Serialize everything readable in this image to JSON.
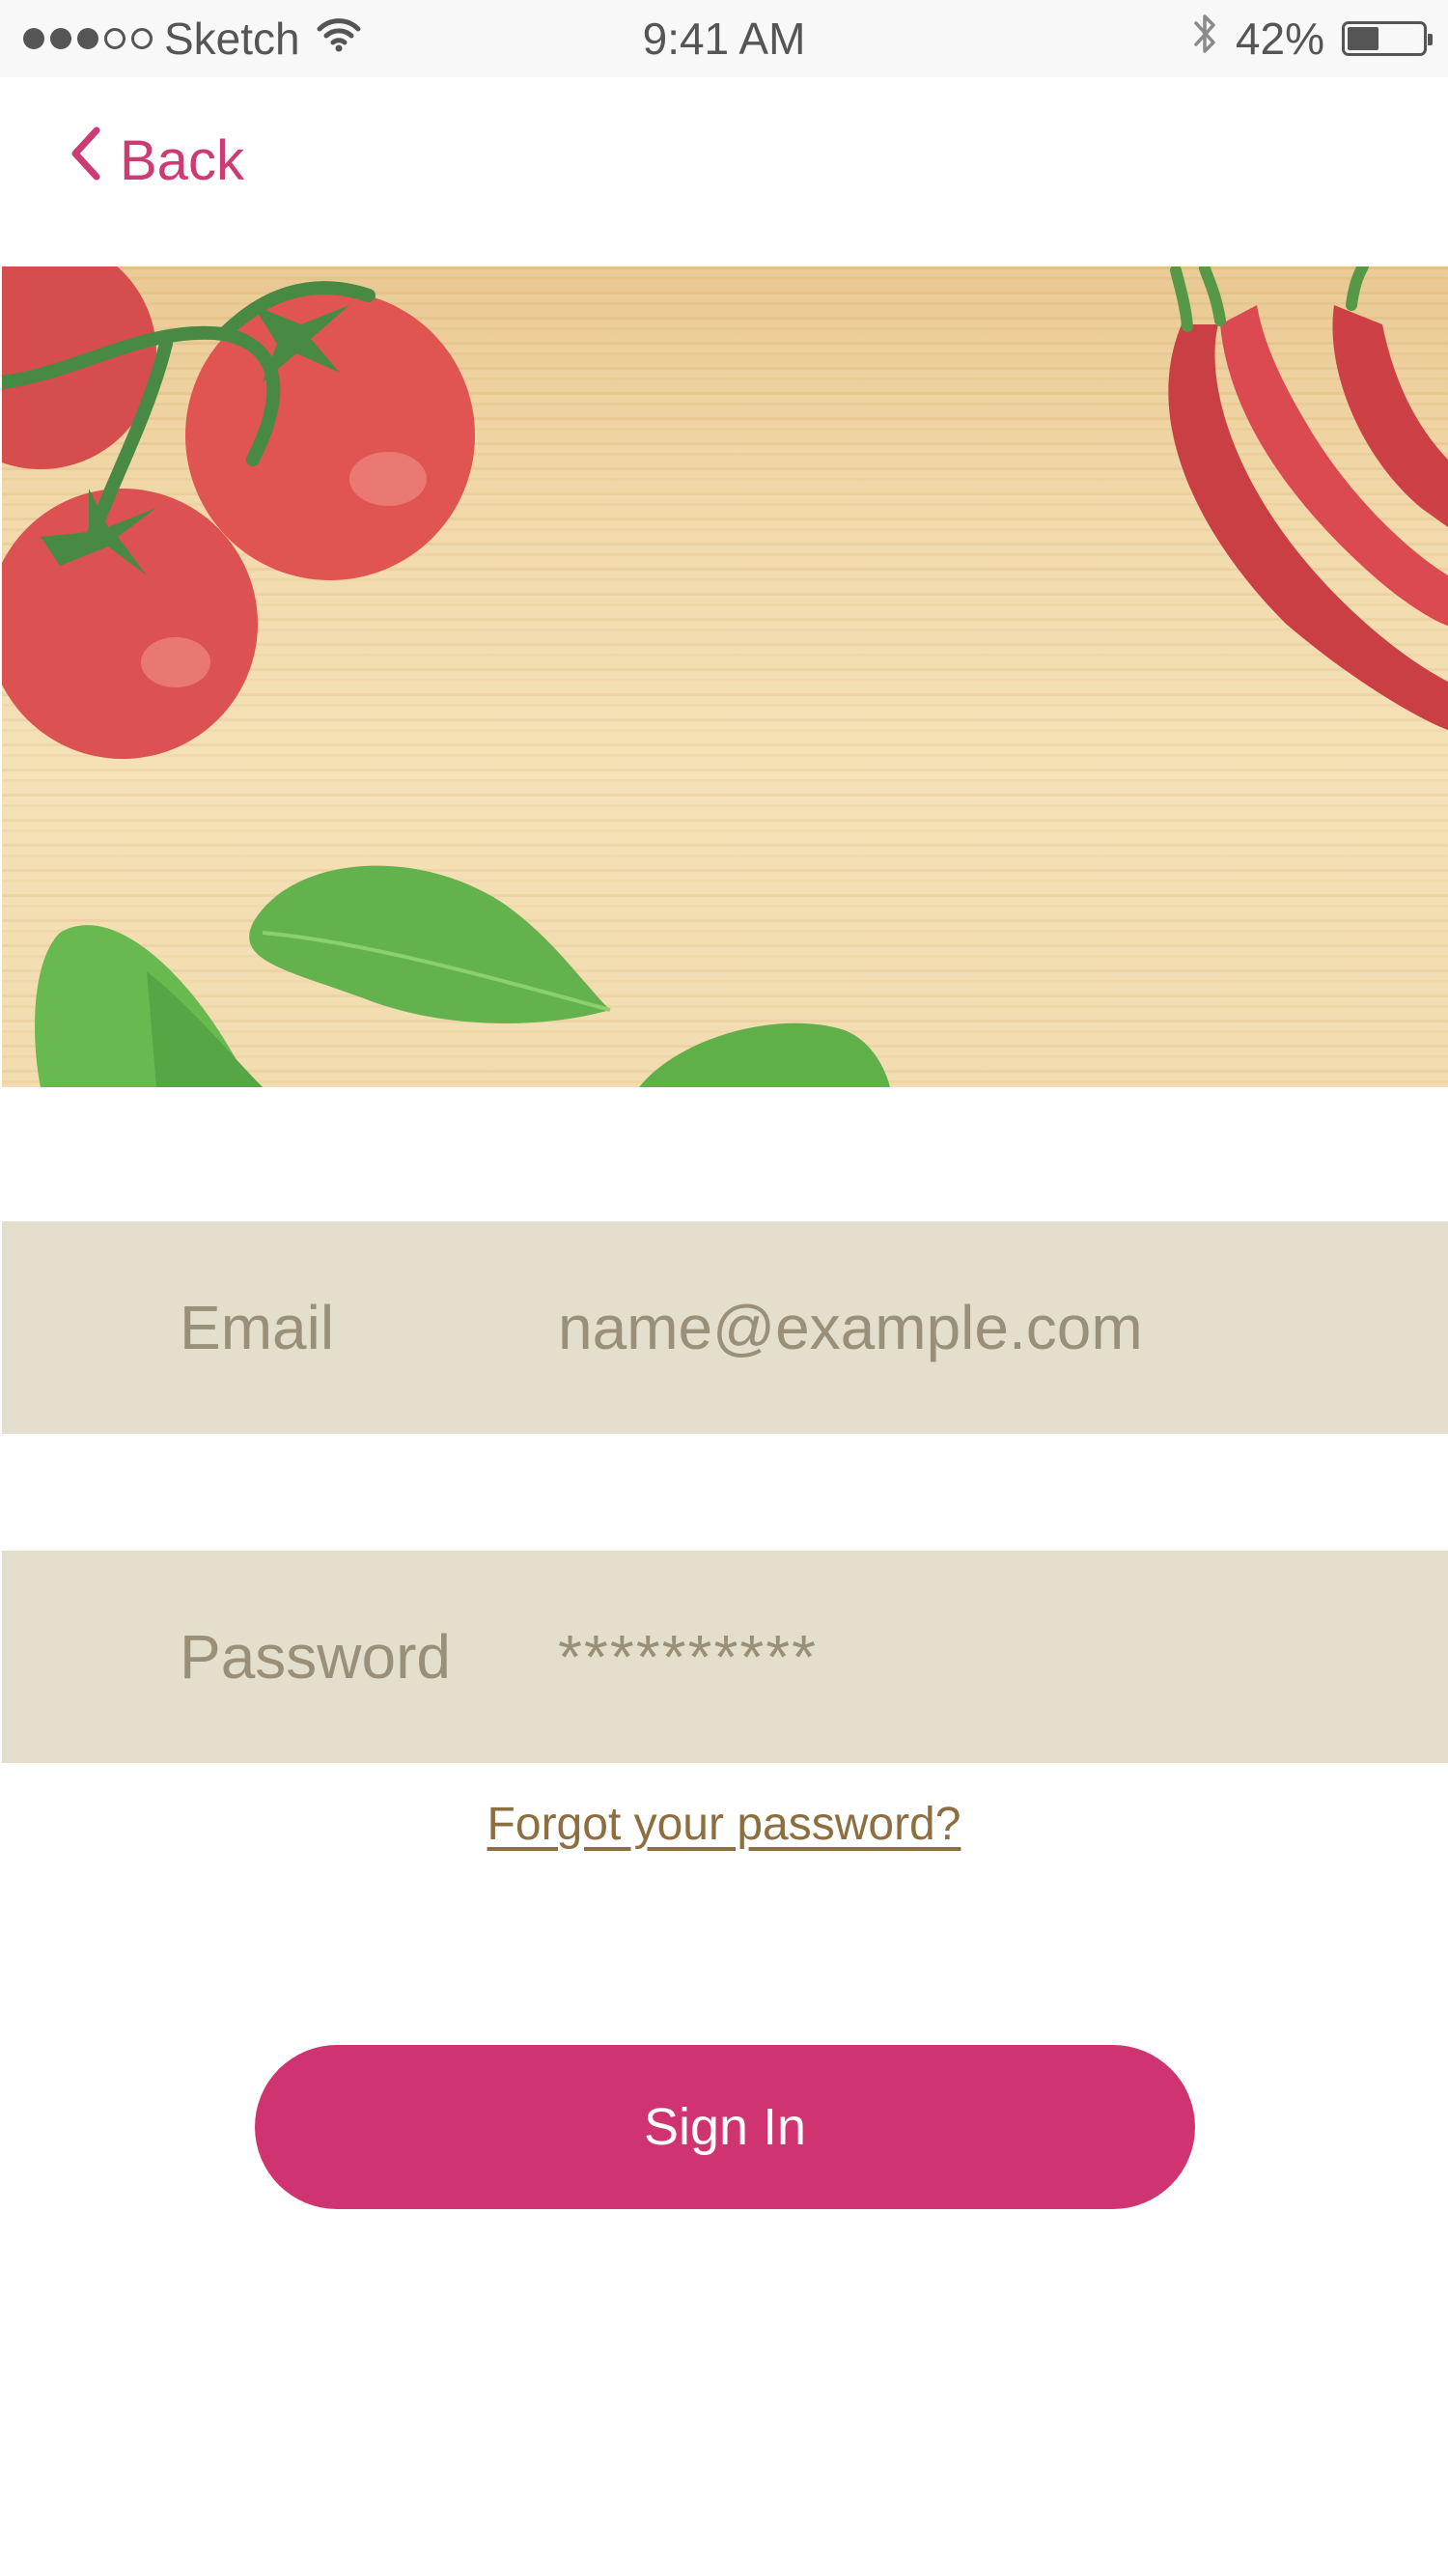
{
  "status_bar": {
    "carrier": "Sketch",
    "time": "9:41 AM",
    "battery_percent": "42%",
    "battery_level": 0.42,
    "signal_bars_filled": 3,
    "signal_bars_total": 5,
    "icons": [
      "signal-dots-icon",
      "wifi-icon",
      "bluetooth-icon",
      "battery-icon"
    ]
  },
  "nav": {
    "back_label": "Back",
    "back_icon": "chevron-left-icon"
  },
  "hero": {
    "image_subject": "tomatoes, red chili peppers and basil leaves on a wooden cutting board"
  },
  "form": {
    "email_label": "Email",
    "email_placeholder": "name@example.com",
    "password_label": "Password",
    "password_value": "**********",
    "forgot_label": "Forgot your password?",
    "signin_label": "Sign In"
  },
  "colors": {
    "accent": "#cf3470",
    "back_text": "#cd3b74",
    "field_background": "#e3dfcc",
    "field_text": "#9a8f78",
    "link": "#8c6e3f",
    "status_text": "#555555"
  }
}
